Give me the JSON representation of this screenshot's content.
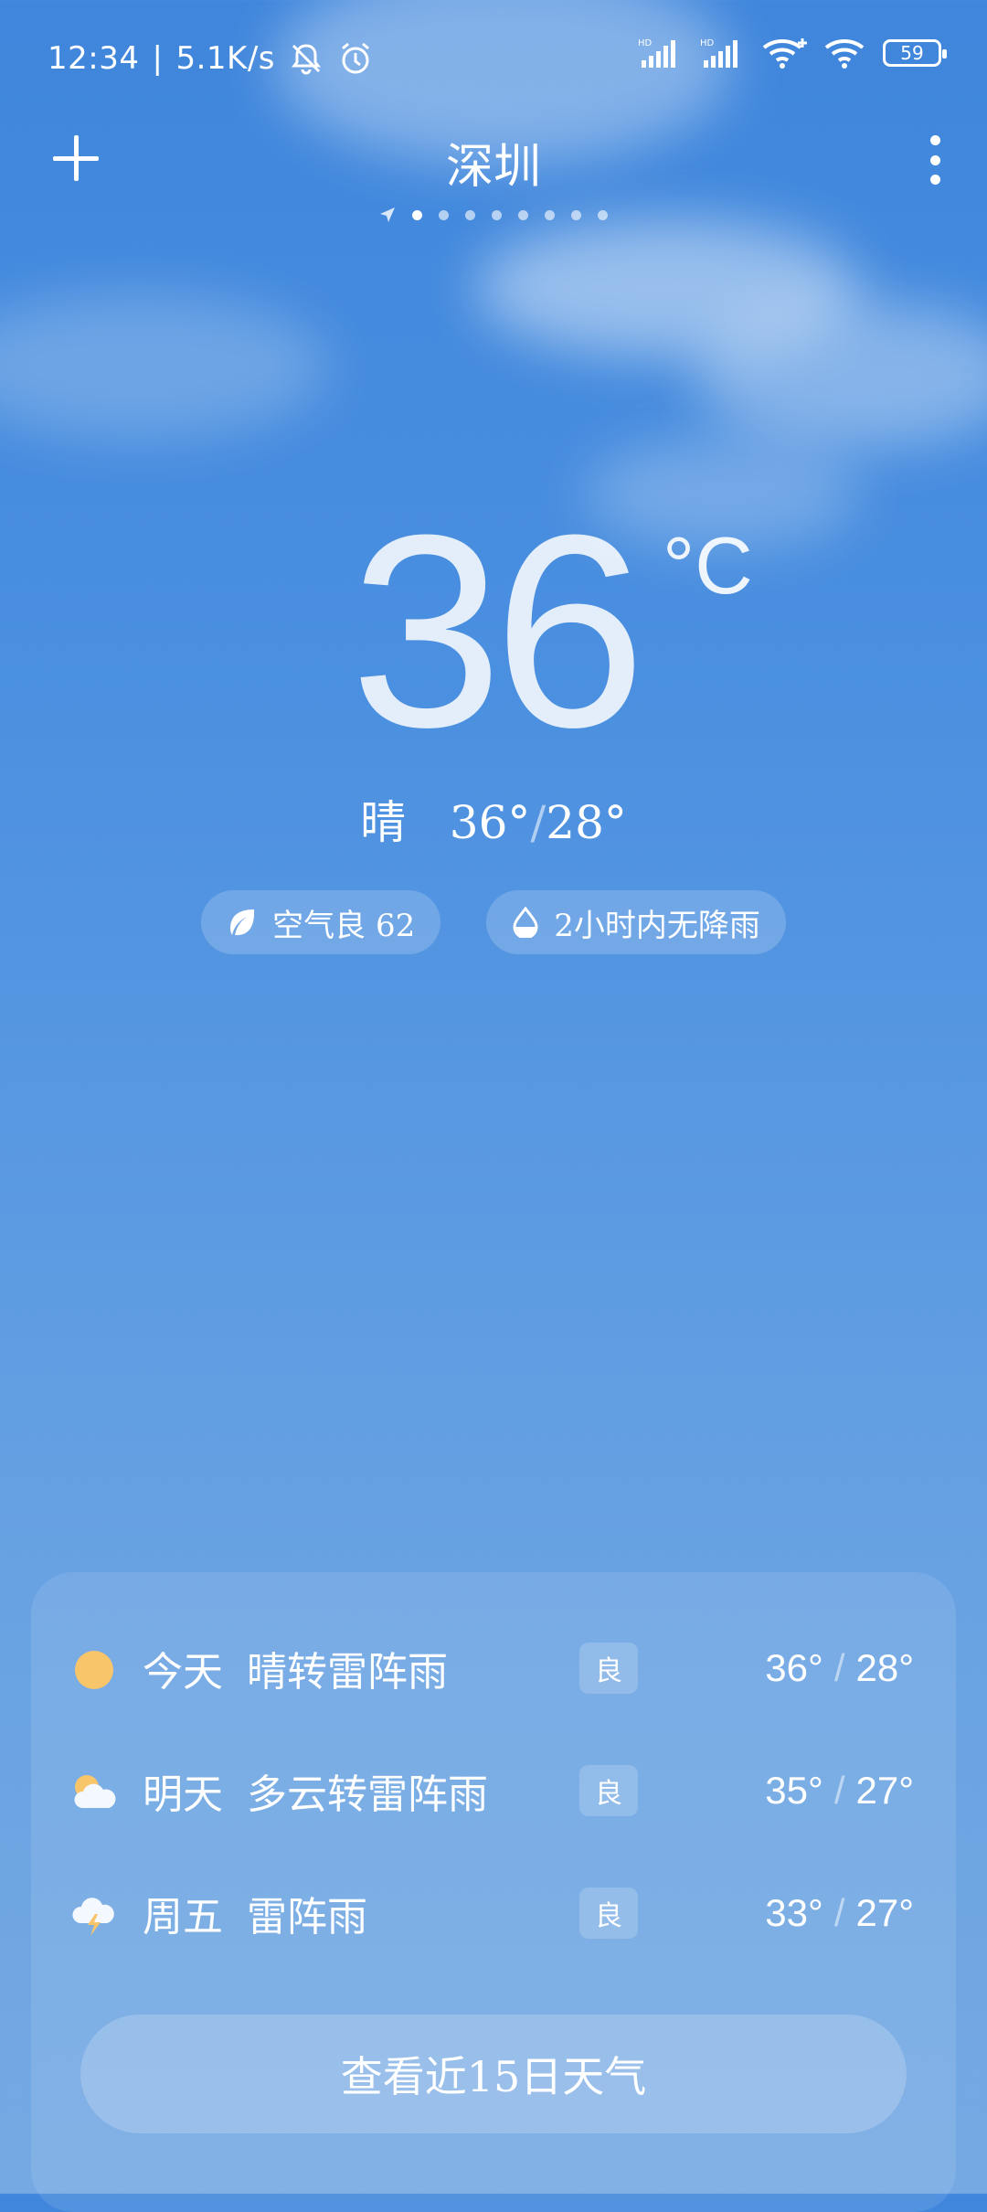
{
  "status_bar": {
    "time": "12:34",
    "divider": "|",
    "net_speed": "5.1K/s",
    "battery": "59",
    "icons": [
      "mute-bell-icon",
      "alarm-icon",
      "hd-signal-icon",
      "hd-signal-icon",
      "wifi-plus-icon",
      "wifi-icon",
      "battery-icon"
    ]
  },
  "header": {
    "city": "深圳",
    "page_dots": 8,
    "active_dot": 0
  },
  "current": {
    "temperature": "36",
    "unit": "°C",
    "condition": "晴",
    "high": "36°",
    "sep": "/",
    "low": "28°"
  },
  "chips": {
    "air_quality": "空气良 62",
    "rain": "2小时内无降雨"
  },
  "forecast": [
    {
      "day": "今天",
      "desc": "晴转雷阵雨",
      "aq": "良",
      "high": "36°",
      "sep": "/",
      "low": "28°",
      "icon": "sun-icon"
    },
    {
      "day": "明天",
      "desc": "多云转雷阵雨",
      "aq": "良",
      "high": "35°",
      "sep": "/",
      "low": "27°",
      "icon": "partly-cloudy-icon"
    },
    {
      "day": "周五",
      "desc": "雷阵雨",
      "aq": "良",
      "high": "33°",
      "sep": "/",
      "low": "27°",
      "icon": "thunderstorm-icon"
    }
  ],
  "more_button": "查看近15日天气",
  "colors": {
    "sun": "#f9c56b",
    "background_top": "#3f86dc",
    "background_bottom": "#74a9e3"
  }
}
